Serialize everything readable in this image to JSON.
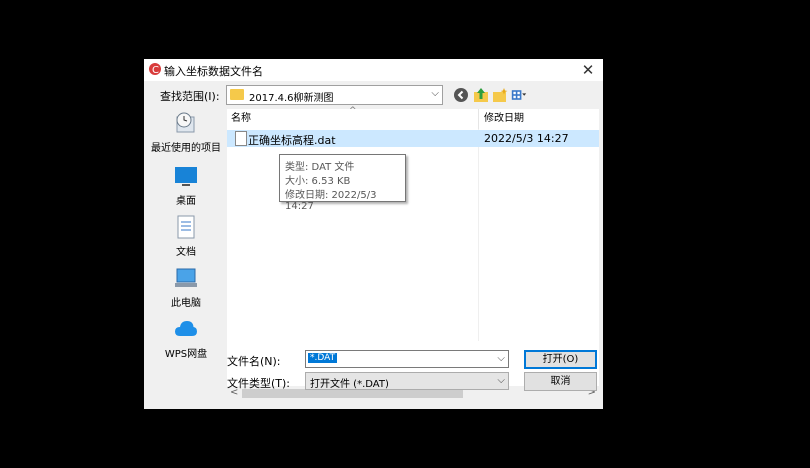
{
  "dialog": {
    "title": "输入坐标数据文件名",
    "close_glyph": "✕"
  },
  "toolbar": {
    "lookin_label": "查找范围(I):",
    "lookin_value": "2017.4.6柳新测图",
    "back_icon": "back-icon",
    "up_icon": "up-folder-icon",
    "newfolder_icon": "new-folder-icon",
    "view_icon": "view-menu-icon"
  },
  "places": [
    {
      "label": "最近使用的项目",
      "icon": "recent-items-icon"
    },
    {
      "label": "桌面",
      "icon": "desktop-icon"
    },
    {
      "label": "文档",
      "icon": "documents-icon"
    },
    {
      "label": "此电脑",
      "icon": "this-pc-icon"
    },
    {
      "label": "WPS网盘",
      "icon": "wps-cloud-icon"
    }
  ],
  "filelist": {
    "columns": [
      "名称",
      "修改日期"
    ],
    "files": [
      {
        "name": "正确坐标高程.dat",
        "modified": "2022/5/3 14:27",
        "selected": true
      }
    ]
  },
  "tooltip": {
    "type_line": "类型: DAT 文件",
    "size_line": "大小: 6.53 KB",
    "date_line": "修改日期: 2022/5/3 14:27"
  },
  "form": {
    "filename_label": "文件名(N):",
    "filename_value": "*.DAT",
    "filetype_label": "文件类型(T):",
    "filetype_value": "打开文件 (*.DAT)",
    "open_label": "打开(O)",
    "cancel_label": "取消"
  },
  "colors": {
    "selection": "#cce8ff",
    "accent": "#0078d7"
  }
}
